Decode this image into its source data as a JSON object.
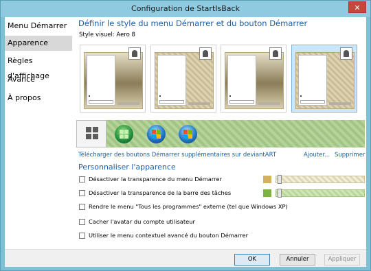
{
  "window": {
    "title": "Configuration de StartIsBack",
    "close_glyph": "✕"
  },
  "sidebar": {
    "items": [
      {
        "label": "Menu Démarrer"
      },
      {
        "label": "Apparence"
      },
      {
        "label": "Règles d'affichage"
      },
      {
        "label": "Avancé"
      },
      {
        "label": "À propos"
      }
    ],
    "active_index": 1
  },
  "main": {
    "heading": "Définir le style du menu Démarrer et du bouton Démarrer",
    "visual_style": "Style visuel:  Aero 8",
    "previews_selected_index": 3,
    "links": {
      "download": "Télécharger des boutons Démarrer supplémentaires sur deviantART",
      "add": "Ajouter...",
      "remove": "Supprimer"
    },
    "customize_heading": "Personnaliser l'apparence",
    "options": [
      {
        "label": "Désactiver la transparence du menu Démarrer",
        "checked": false,
        "swatch_color": "#d4b060"
      },
      {
        "label": "Désactiver la transparence de la barre des tâches",
        "checked": false,
        "swatch_color": "#7cb342"
      },
      {
        "label": "Rendre le menu \"Tous les programmes\" externe (tel que Windows XP)",
        "checked": false
      },
      {
        "label": "Cacher l'avatar du compte utilisateur",
        "checked": false
      },
      {
        "label": "Utiliser le menu contextuel avancé du bouton Démarrer",
        "checked": false
      }
    ]
  },
  "footer": {
    "ok": "OK",
    "cancel": "Annuler",
    "apply": "Appliquer"
  }
}
